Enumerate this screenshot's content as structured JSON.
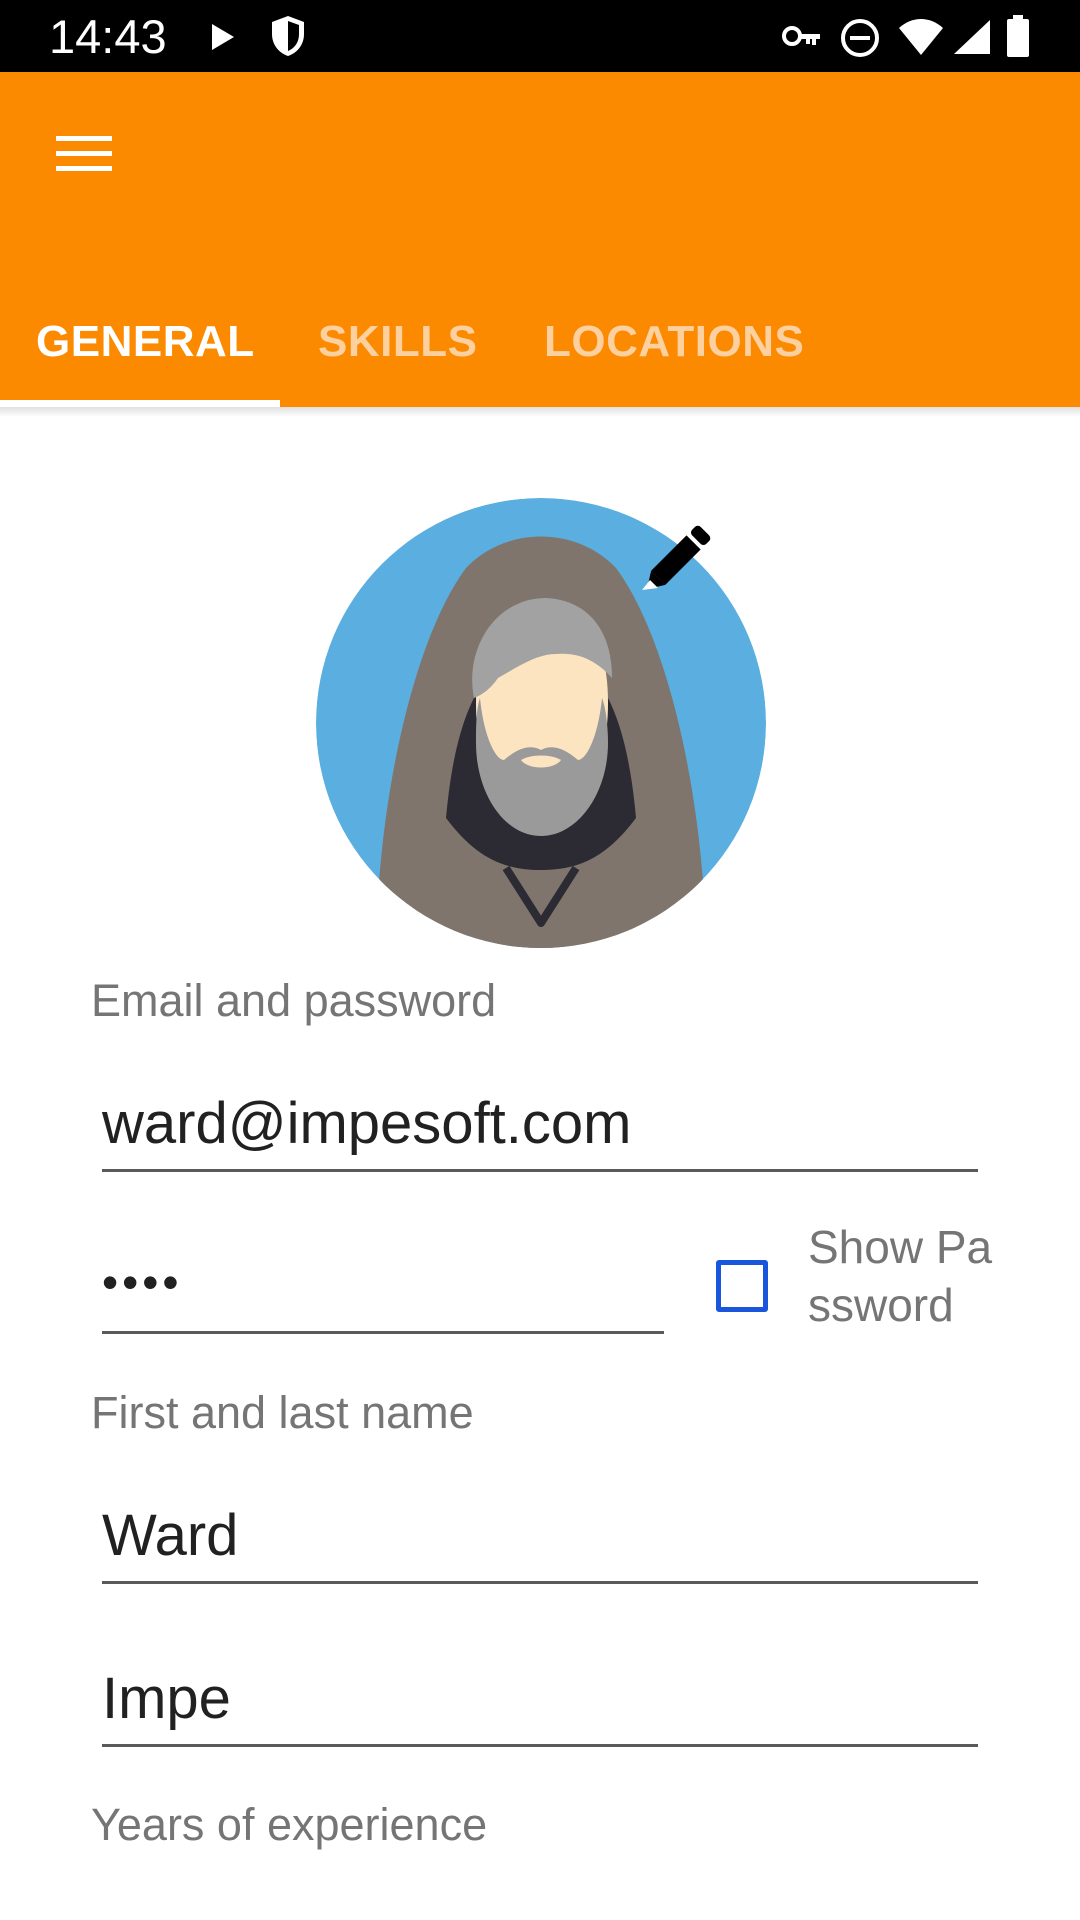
{
  "status_bar": {
    "time": "14:43",
    "left_icons": [
      "play-icon",
      "shield-icon"
    ],
    "right_icons": [
      "vpn-key-icon",
      "do-not-disturb-icon",
      "wifi-icon",
      "signal-icon",
      "battery-icon"
    ]
  },
  "app_bar": {
    "menu_icon": "hamburger-menu-icon",
    "tabs": [
      {
        "label": "GENERAL",
        "selected": true
      },
      {
        "label": "SKILLS",
        "selected": false
      },
      {
        "label": "LOCATIONS",
        "selected": false
      }
    ]
  },
  "profile": {
    "avatar_icon": "hooded-bearded-man-avatar",
    "edit_icon": "pencil-icon"
  },
  "form": {
    "email_section_label": "Email and password",
    "email_value": "ward@impesoft.com",
    "password_value": "••••",
    "show_password_label": "Show Password",
    "show_password_checked": false,
    "name_section_label": "First and last name",
    "first_name_value": "Ward",
    "last_name_value": "Impe",
    "experience_section_label": "Years of experience"
  },
  "colors": {
    "primary": "#FB8A00",
    "tab_selected": "#FFFFFF",
    "tab_unselected": "#FDD0A0",
    "checkbox_accent": "#1A56DB",
    "section_label": "#757575",
    "avatar_bg": "#5AAFE0"
  }
}
